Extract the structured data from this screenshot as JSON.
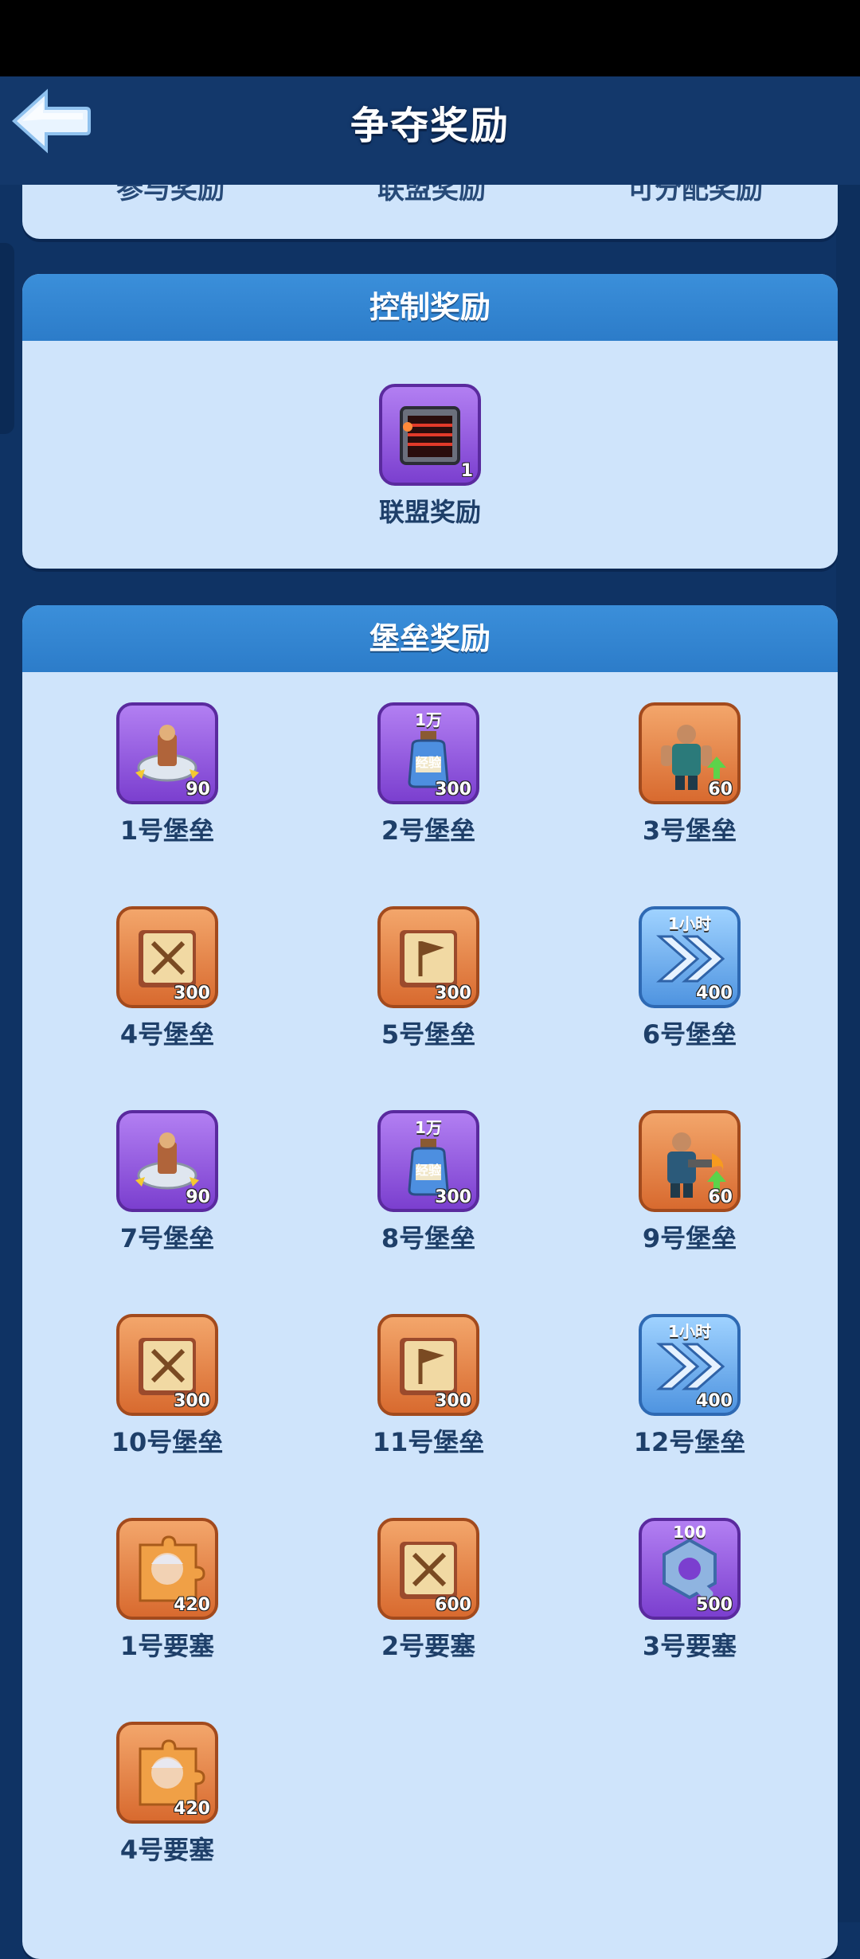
{
  "header": {
    "title": "争夺奖励"
  },
  "prev_section_tabs": [
    "参与奖励",
    "联盟奖励",
    "可分配奖励"
  ],
  "control_rewards": {
    "title": "控制奖励",
    "items": [
      {
        "label": "联盟奖励",
        "count": "1",
        "icon": "red-chest-icon",
        "frame": "purple"
      }
    ]
  },
  "fort_rewards": {
    "title": "堡垒奖励",
    "items": [
      {
        "label": "1号堡垒",
        "count": "90",
        "icon": "turret-icon",
        "frame": "purple",
        "top": ""
      },
      {
        "label": "2号堡垒",
        "count": "300",
        "icon": "exp-potion-icon",
        "frame": "purple",
        "top": "1万",
        "badge": "经验"
      },
      {
        "label": "3号堡垒",
        "count": "60",
        "icon": "soldier-upgrade-icon",
        "frame": "orange",
        "top": ""
      },
      {
        "label": "4号堡垒",
        "count": "300",
        "icon": "tome-swords-icon",
        "frame": "orange",
        "top": ""
      },
      {
        "label": "5号堡垒",
        "count": "300",
        "icon": "tome-flag-icon",
        "frame": "orange",
        "top": ""
      },
      {
        "label": "6号堡垒",
        "count": "400",
        "icon": "speedup-icon",
        "frame": "blue",
        "top": "1小时"
      },
      {
        "label": "7号堡垒",
        "count": "90",
        "icon": "turret-icon",
        "frame": "purple",
        "top": ""
      },
      {
        "label": "8号堡垒",
        "count": "300",
        "icon": "exp-potion-icon",
        "frame": "purple",
        "top": "1万",
        "badge": "经验"
      },
      {
        "label": "9号堡垒",
        "count": "60",
        "icon": "flamethrower-upgrade-icon",
        "frame": "orange",
        "top": ""
      },
      {
        "label": "10号堡垒",
        "count": "300",
        "icon": "tome-swords-icon",
        "frame": "orange",
        "top": ""
      },
      {
        "label": "11号堡垒",
        "count": "300",
        "icon": "tome-flag-icon",
        "frame": "orange",
        "top": ""
      },
      {
        "label": "12号堡垒",
        "count": "400",
        "icon": "speedup-icon",
        "frame": "blue",
        "top": "1小时"
      },
      {
        "label": "1号要塞",
        "count": "420",
        "icon": "hero-puzzle-icon",
        "frame": "orange",
        "top": ""
      },
      {
        "label": "2号要塞",
        "count": "600",
        "icon": "tome-swords-icon",
        "frame": "orange",
        "top": ""
      },
      {
        "label": "3号要塞",
        "count": "500",
        "icon": "gear-nut-icon",
        "frame": "purple",
        "top": "100"
      },
      {
        "label": "4号要塞",
        "count": "420",
        "icon": "hero-puzzle-icon",
        "frame": "orange",
        "top": ""
      }
    ]
  },
  "colors": {
    "background": "#0f3364",
    "card": "#cfe4fb",
    "card_header": "#2c7cc9",
    "label_text": "#1e3f69"
  }
}
